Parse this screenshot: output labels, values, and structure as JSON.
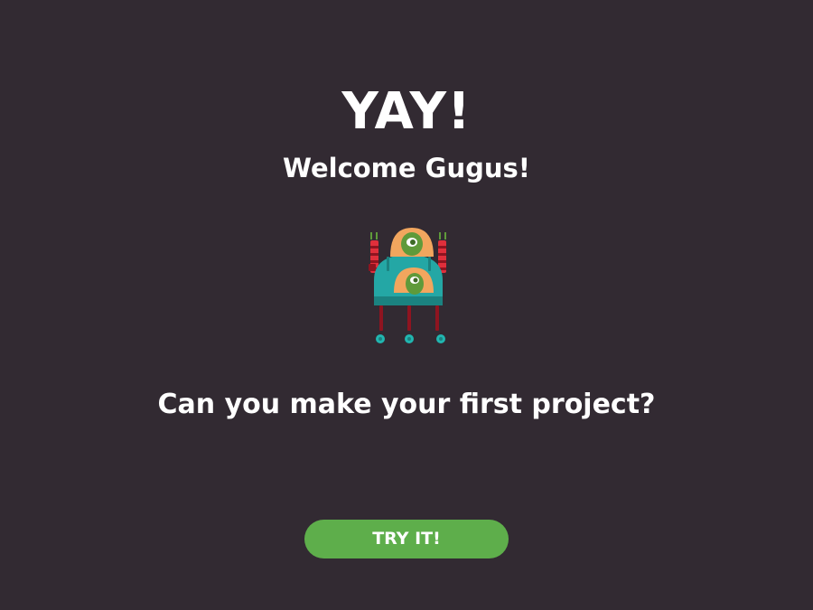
{
  "colors": {
    "background": "#322a32",
    "text": "#ffffff",
    "button": "#5eae4b",
    "button_text": "#ffffff",
    "robot_teal": "#24a7a5",
    "robot_teal_dark": "#1b8280",
    "robot_orange": "#f2a65e",
    "robot_red": "#e02f3b",
    "robot_dark_red": "#8f1420",
    "alien_green": "#5f9a3a",
    "alien_green_dark": "#3d6a26",
    "wheel_teal": "#21b6b0"
  },
  "welcome": {
    "title": "YAY!",
    "greeting": "Welcome Gugus!",
    "mascot_icon": "robot-mascot-icon",
    "question": "Can you make your first project?",
    "cta_label": "TRY IT!"
  }
}
